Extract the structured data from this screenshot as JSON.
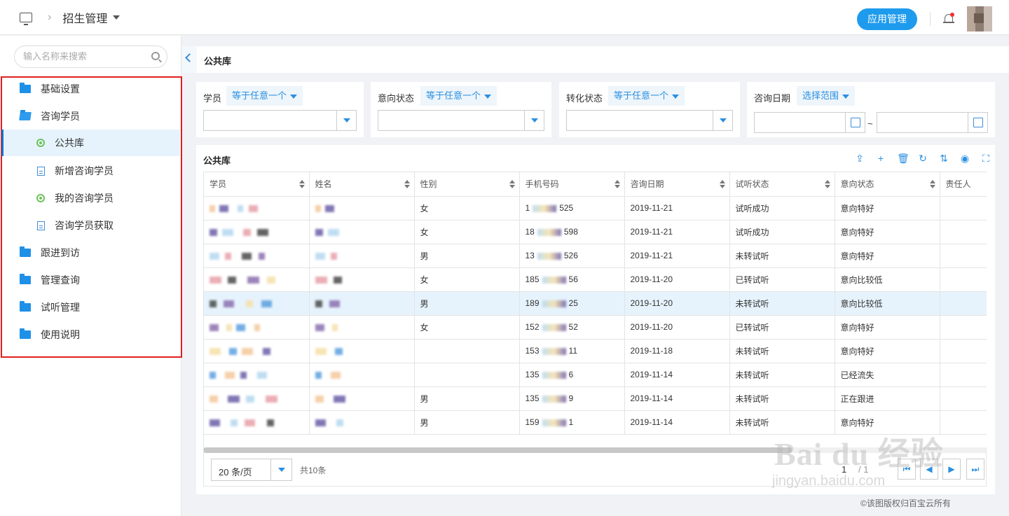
{
  "header": {
    "title": "招生管理",
    "app_button": "应用管理"
  },
  "sidebar": {
    "search_placeholder": "输入名称来搜索",
    "items": [
      {
        "label": "基础设置"
      },
      {
        "label": "咨询学员"
      },
      {
        "label": "公共库"
      },
      {
        "label": "新增咨询学员"
      },
      {
        "label": "我的咨询学员"
      },
      {
        "label": "咨询学员获取"
      },
      {
        "label": "跟进到访"
      },
      {
        "label": "管理查询"
      },
      {
        "label": "试听管理"
      },
      {
        "label": "使用说明"
      }
    ]
  },
  "main": {
    "title": "公共库"
  },
  "filters": [
    {
      "label": "学员",
      "op": "等于任意一个"
    },
    {
      "label": "意向状态",
      "op": "等于任意一个"
    },
    {
      "label": "转化状态",
      "op": "等于任意一个"
    },
    {
      "label": "咨询日期",
      "op": "选择范围"
    }
  ],
  "date_sep": "~",
  "table": {
    "title": "公共库",
    "columns": [
      "学员",
      "姓名",
      "性别",
      "手机号码",
      "咨询日期",
      "试听状态",
      "意向状态",
      "责任人"
    ],
    "rows": [
      {
        "gender": "女",
        "phone_a": "1",
        "phone_b": "525",
        "date": "2019-11-21",
        "trial": "试听成功",
        "intent": "意向特好"
      },
      {
        "gender": "女",
        "phone_a": "18",
        "phone_b": "598",
        "date": "2019-11-21",
        "trial": "试听成功",
        "intent": "意向特好"
      },
      {
        "gender": "男",
        "phone_a": "13",
        "phone_b": "526",
        "date": "2019-11-21",
        "trial": "未转试听",
        "intent": "意向特好"
      },
      {
        "gender": "女",
        "phone_a": "185",
        "phone_b": "56",
        "date": "2019-11-20",
        "trial": "已转试听",
        "intent": "意向比较低"
      },
      {
        "gender": "男",
        "phone_a": "189",
        "phone_b": "25",
        "date": "2019-11-20",
        "trial": "未转试听",
        "intent": "意向比较低"
      },
      {
        "gender": "女",
        "phone_a": "152",
        "phone_b": "52",
        "date": "2019-11-20",
        "trial": "已转试听",
        "intent": "意向特好"
      },
      {
        "gender": "",
        "phone_a": "153",
        "phone_b": "11",
        "date": "2019-11-18",
        "trial": "未转试听",
        "intent": "意向特好"
      },
      {
        "gender": "",
        "phone_a": "135",
        "phone_b": "6",
        "date": "2019-11-14",
        "trial": "未转试听",
        "intent": "已经流失"
      },
      {
        "gender": "男",
        "phone_a": "135",
        "phone_b": "9",
        "date": "2019-11-14",
        "trial": "未转试听",
        "intent": "正在跟进"
      },
      {
        "gender": "男",
        "phone_a": "159",
        "phone_b": "1",
        "date": "2019-11-14",
        "trial": "未转试听",
        "intent": "意向特好"
      }
    ]
  },
  "pager": {
    "page_size": "20 条/页",
    "total": "共10条",
    "current": "1",
    "pages": "/ 1"
  },
  "watermark": {
    "main": "Bai du 经验",
    "sub": "jingyan.baidu.com"
  },
  "copyright": "©该图版权归百宝云所有",
  "colors": {
    "accent": "#1e9bed",
    "selected_row": "#e6f3fc",
    "highlight_border": "#e02020"
  }
}
